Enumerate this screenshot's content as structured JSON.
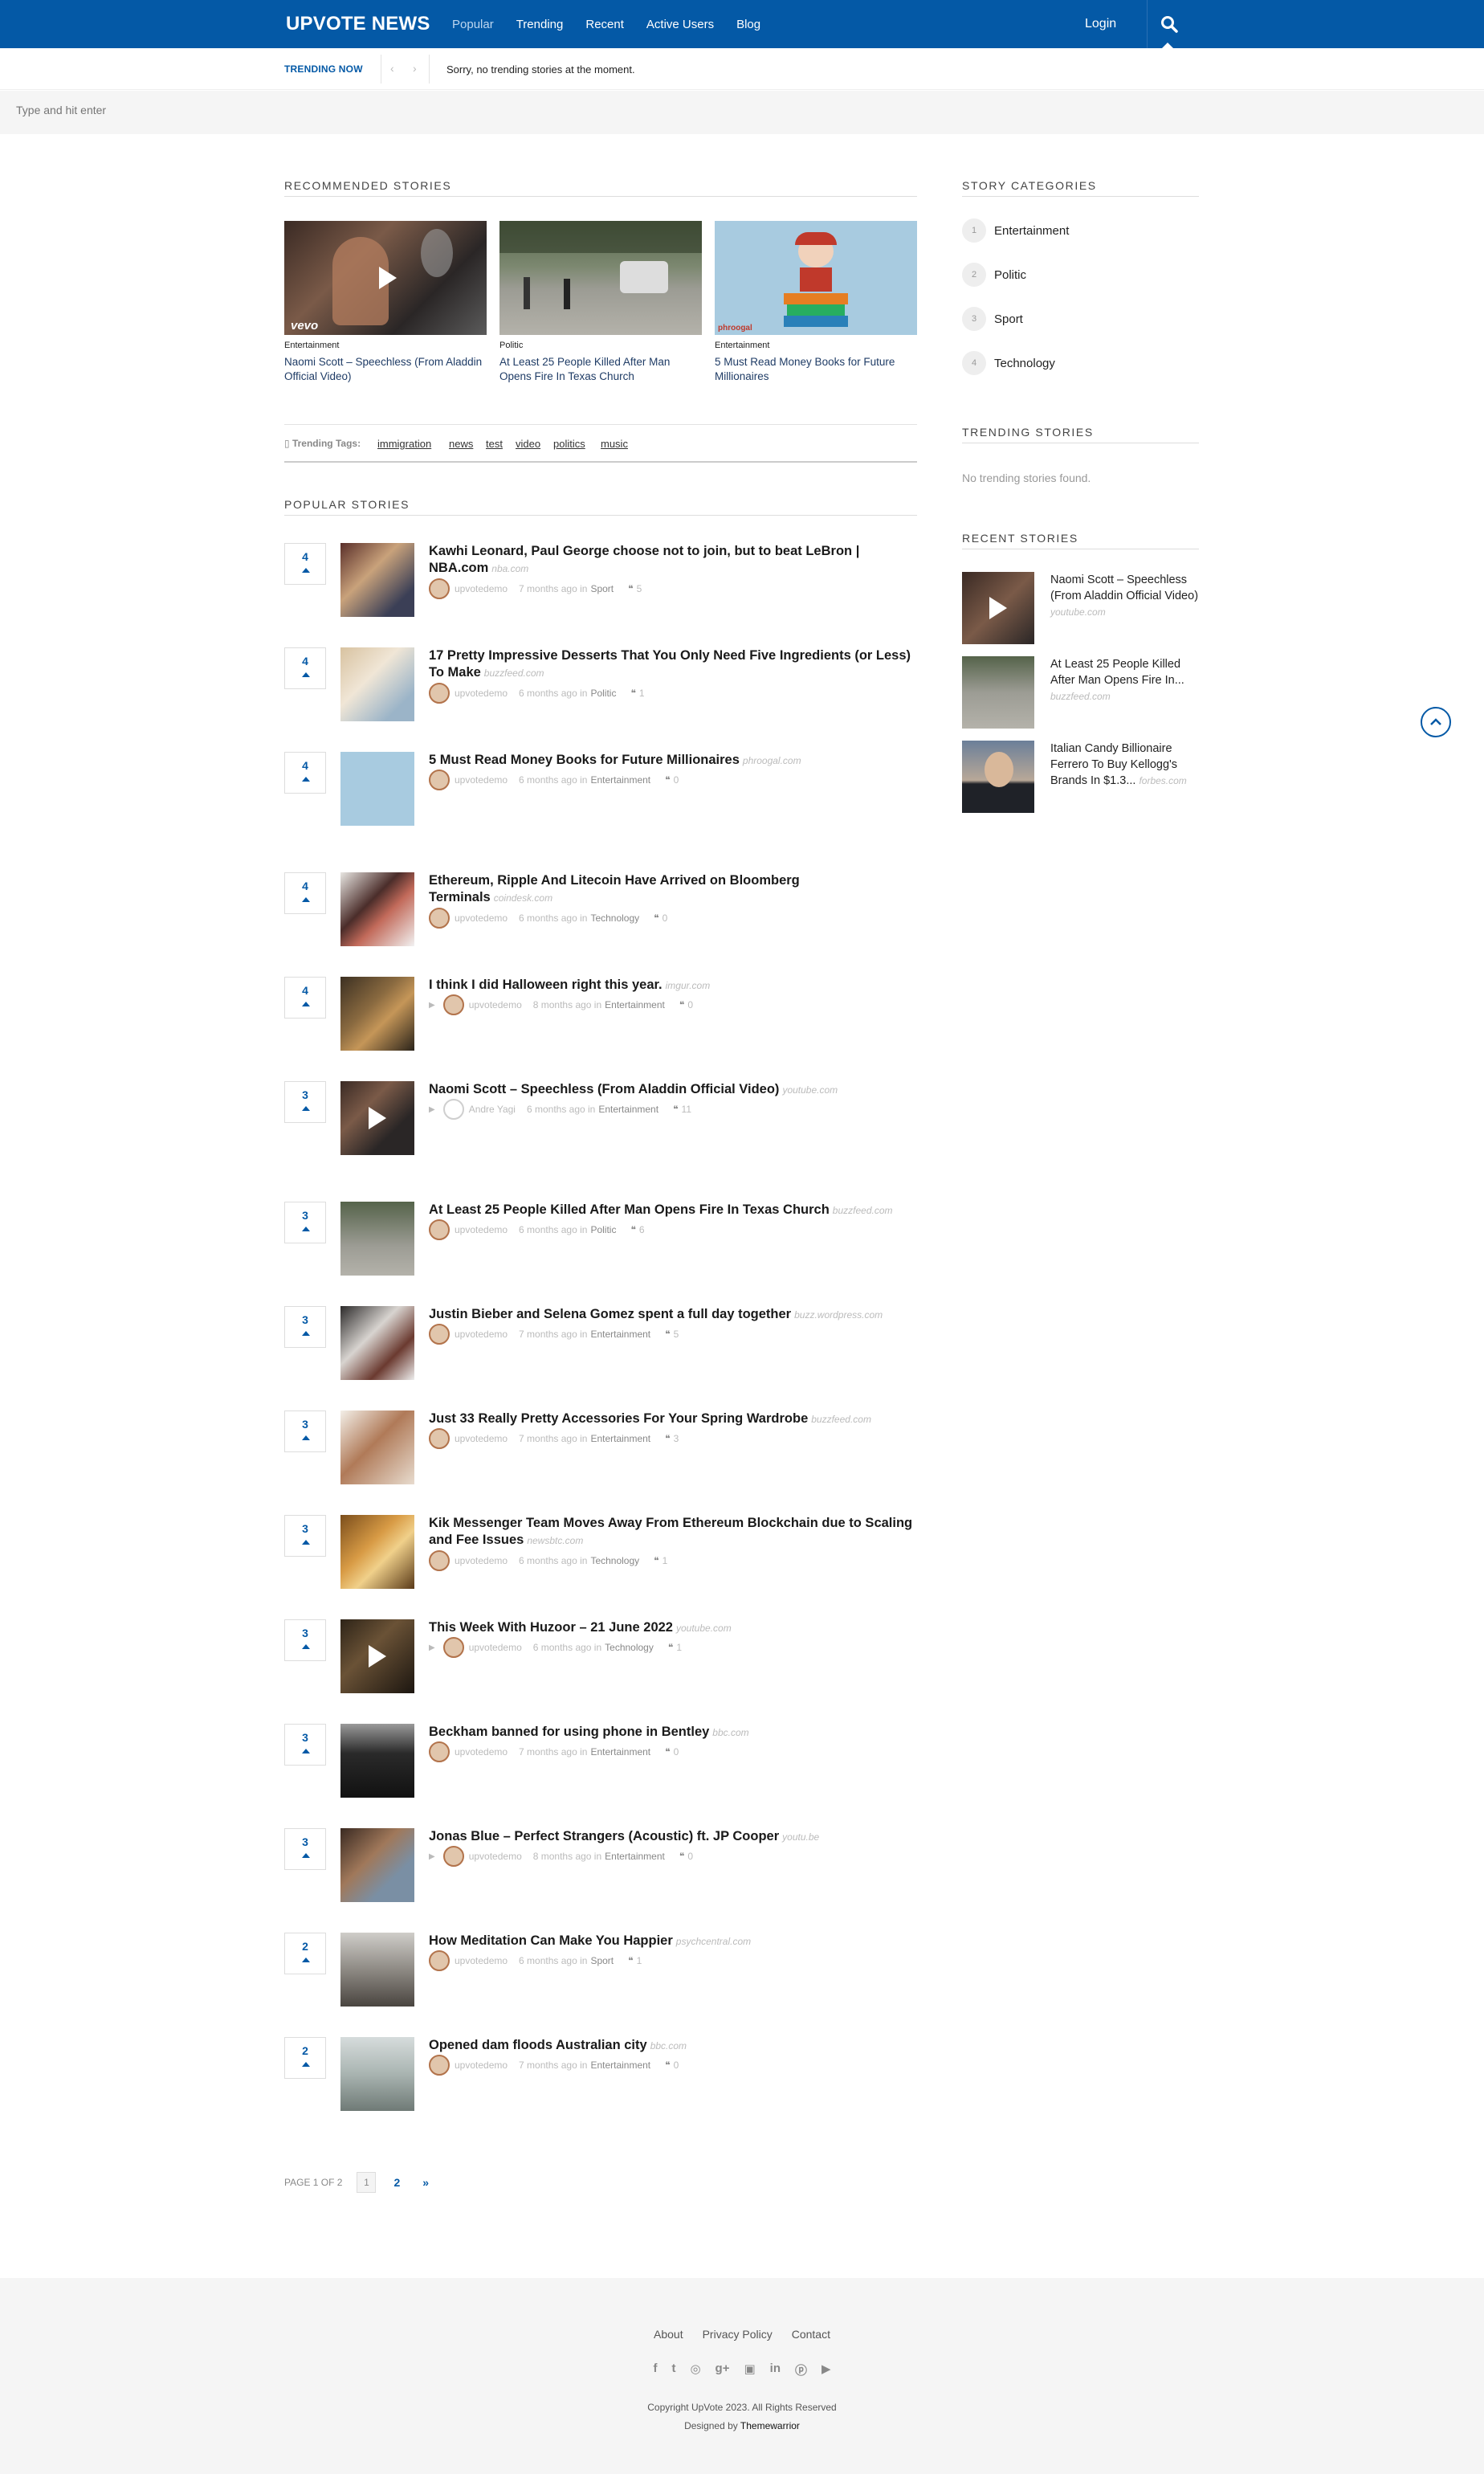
{
  "header": {
    "logo": "UPVOTE NEWS",
    "nav": [
      "Popular",
      "Trending",
      "Recent",
      "Active Users",
      "Blog"
    ],
    "login": "Login"
  },
  "trending_bar": {
    "label": "TRENDING NOW",
    "message": "Sorry, no trending stories at the moment."
  },
  "search": {
    "placeholder": "Type and hit enter"
  },
  "recommended": {
    "title": "RECOMMENDED STORIES",
    "items": [
      {
        "category": "Entertainment",
        "title": "Naomi Scott – Speechless (From Aladdin Official Video)",
        "badge": "vevo"
      },
      {
        "category": "Politic",
        "title": "At Least 25 People Killed After Man Opens Fire In Texas Church"
      },
      {
        "category": "Entertainment",
        "title": "5 Must Read Money Books for Future Millionaires",
        "badge": "phroogal"
      }
    ],
    "tags_label": "Trending Tags:",
    "tags": [
      "immigration",
      "news",
      "test",
      "video",
      "politics",
      "music"
    ]
  },
  "popular": {
    "title": "POPULAR STORIES",
    "stories": [
      {
        "votes": "4",
        "title": "Kawhi Leonard, Paul George choose not to join, but to beat LeBron | NBA.com",
        "source": "nba.com",
        "author": "upvotedemo",
        "time": "7 months ago in",
        "category": "Sport",
        "comments": "5"
      },
      {
        "votes": "4",
        "title": "17 Pretty Impressive Desserts That You Only Need Five Ingredients (or Less) To Make",
        "source": "buzzfeed.com",
        "author": "upvotedemo",
        "time": "6 months ago in",
        "category": "Politic",
        "comments": "1"
      },
      {
        "votes": "4",
        "title": "5 Must Read Money Books for Future Millionaires",
        "source": "phroogal.com",
        "author": "upvotedemo",
        "time": "6 months ago in",
        "category": "Entertainment",
        "comments": "0"
      },
      {
        "votes": "4",
        "title": "Ethereum, Ripple And Litecoin Have Arrived on Bloomberg Terminals",
        "source": "coindesk.com",
        "author": "upvotedemo",
        "time": "6 months ago in",
        "category": "Technology",
        "comments": "0"
      },
      {
        "votes": "4",
        "title": "I think I did Halloween right this year.",
        "source": "imgur.com",
        "author": "upvotedemo",
        "time": "8 months ago in",
        "category": "Entertainment",
        "comments": "0"
      },
      {
        "votes": "3",
        "title": "Naomi Scott – Speechless (From Aladdin Official Video)",
        "source": "youtube.com",
        "author": "Andre Yagi",
        "time": "6 months ago in",
        "category": "Entertainment",
        "comments": "11"
      },
      {
        "votes": "3",
        "title": "At Least 25 People Killed After Man Opens Fire In Texas Church",
        "source": "buzzfeed.com",
        "author": "upvotedemo",
        "time": "6 months ago in",
        "category": "Politic",
        "comments": "6"
      },
      {
        "votes": "3",
        "title": "Justin Bieber and Selena Gomez spent a full day together",
        "source": "buzz.wordpress.com",
        "author": "upvotedemo",
        "time": "7 months ago in",
        "category": "Entertainment",
        "comments": "5"
      },
      {
        "votes": "3",
        "title": "Just 33 Really Pretty Accessories For Your Spring Wardrobe",
        "source": "buzzfeed.com",
        "author": "upvotedemo",
        "time": "7 months ago in",
        "category": "Entertainment",
        "comments": "3"
      },
      {
        "votes": "3",
        "title": "Kik Messenger Team Moves Away From Ethereum Blockchain due to Scaling and Fee Issues",
        "source": "newsbtc.com",
        "author": "upvotedemo",
        "time": "6 months ago in",
        "category": "Technology",
        "comments": "1"
      },
      {
        "votes": "3",
        "title": "This Week With Huzoor – 21 June 2022",
        "source": "youtube.com",
        "author": "upvotedemo",
        "time": "6 months ago in",
        "category": "Technology",
        "comments": "1"
      },
      {
        "votes": "3",
        "title": "Beckham banned for using phone in Bentley",
        "source": "bbc.com",
        "author": "upvotedemo",
        "time": "7 months ago in",
        "category": "Entertainment",
        "comments": "0"
      },
      {
        "votes": "3",
        "title": "Jonas Blue – Perfect Strangers (Acoustic) ft. JP Cooper",
        "source": "youtu.be",
        "author": "upvotedemo",
        "time": "8 months ago in",
        "category": "Entertainment",
        "comments": "0"
      },
      {
        "votes": "2",
        "title": "How Meditation Can Make You Happier",
        "source": "psychcentral.com",
        "author": "upvotedemo",
        "time": "6 months ago in",
        "category": "Sport",
        "comments": "1"
      },
      {
        "votes": "2",
        "title": "Opened dam floods Australian city",
        "source": "bbc.com",
        "author": "upvotedemo",
        "time": "7 months ago in",
        "category": "Entertainment",
        "comments": "0"
      }
    ]
  },
  "pagination": {
    "label": "PAGE 1 OF 2",
    "current": "1",
    "next_page": "2",
    "next": "»"
  },
  "sidebar": {
    "categories_title": "STORY CATEGORIES",
    "categories": [
      {
        "num": "1",
        "label": "Entertainment"
      },
      {
        "num": "2",
        "label": "Politic"
      },
      {
        "num": "3",
        "label": "Sport"
      },
      {
        "num": "4",
        "label": "Technology"
      }
    ],
    "trending_title": "TRENDING STORIES",
    "trending_empty": "No trending stories found.",
    "recent_title": "RECENT STORIES",
    "recent": [
      {
        "title": "Naomi Scott – Speechless (From Aladdin Official Video)",
        "source": "youtube.com"
      },
      {
        "title": "At Least 25 People Killed After Man Opens Fire In...",
        "source": "buzzfeed.com"
      },
      {
        "title": "Italian Candy Billionaire Ferrero To Buy Kellogg's Brands In $1.3...",
        "source": "forbes.com"
      }
    ]
  },
  "footer": {
    "links": [
      "About",
      "Privacy Policy",
      "Contact"
    ],
    "social": [
      "f",
      "t",
      "◎",
      "g+",
      "▣",
      "in",
      "ⓟ",
      "▶"
    ],
    "copyright": "Copyright UpVote 2023. All Rights Reserved",
    "designed_by_prefix": "Designed by",
    "designed_by": "Themewarrior"
  },
  "colors": {
    "brand": "#0459a6",
    "footer_bg": "#f5f5f5"
  }
}
